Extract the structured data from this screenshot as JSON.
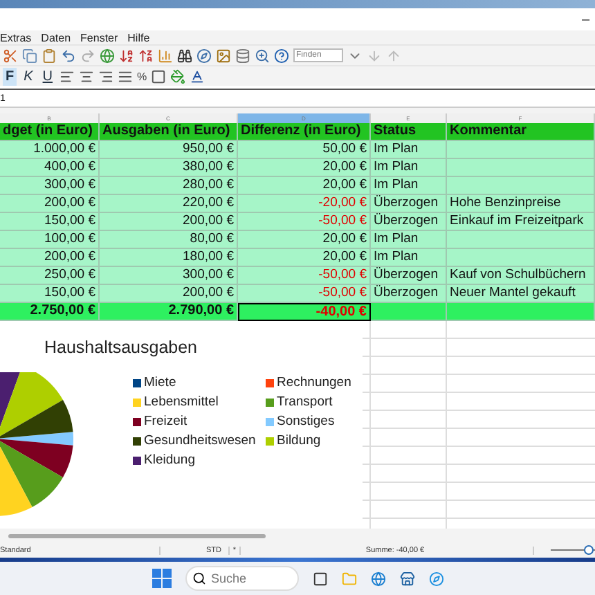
{
  "window": {
    "minimize": "–"
  },
  "menu": [
    {
      "label": "Extras"
    },
    {
      "label": "Daten"
    },
    {
      "label": "Fenster"
    },
    {
      "label": "Hilfe"
    }
  ],
  "find": {
    "placeholder": "Finden"
  },
  "format_buttons": [
    {
      "label": "F",
      "kind": "bold",
      "selected": true
    },
    {
      "label": "K",
      "kind": "italic",
      "selected": false
    },
    {
      "label": "U",
      "kind": "underline",
      "selected": false
    }
  ],
  "percent": "%",
  "formula_bar": {
    "cell": "1"
  },
  "columns": [
    {
      "label": "B",
      "selected": false
    },
    {
      "label": "C",
      "selected": false
    },
    {
      "label": "D",
      "selected": true
    },
    {
      "label": "E",
      "selected": false
    },
    {
      "label": "F",
      "selected": false
    }
  ],
  "header": [
    "dget (in Euro)",
    "Ausgaben (in Euro)",
    "Differenz (in Euro)",
    "Status",
    "Kommentar"
  ],
  "rows": [
    {
      "budget": "1.000,00 €",
      "spent": "950,00 €",
      "diff": "50,00 €",
      "negative": false,
      "status": "Im Plan",
      "comment": ""
    },
    {
      "budget": "400,00 €",
      "spent": "380,00 €",
      "diff": "20,00 €",
      "negative": false,
      "status": "Im Plan",
      "comment": ""
    },
    {
      "budget": "300,00 €",
      "spent": "280,00 €",
      "diff": "20,00 €",
      "negative": false,
      "status": "Im Plan",
      "comment": ""
    },
    {
      "budget": "200,00 €",
      "spent": "220,00 €",
      "diff": "-20,00 €",
      "negative": true,
      "status": "Überzogen",
      "comment": "Hohe Benzinpreise"
    },
    {
      "budget": "150,00 €",
      "spent": "200,00 €",
      "diff": "-50,00 €",
      "negative": true,
      "status": "Überzogen",
      "comment": "Einkauf im Freizeitpark"
    },
    {
      "budget": "100,00 €",
      "spent": "80,00 €",
      "diff": "20,00 €",
      "negative": false,
      "status": "Im Plan",
      "comment": ""
    },
    {
      "budget": "200,00 €",
      "spent": "180,00 €",
      "diff": "20,00 €",
      "negative": false,
      "status": "Im Plan",
      "comment": ""
    },
    {
      "budget": "250,00 €",
      "spent": "300,00 €",
      "diff": "-50,00 €",
      "negative": true,
      "status": "Überzogen",
      "comment": "Kauf von Schulbüchern"
    },
    {
      "budget": "150,00 €",
      "spent": "200,00 €",
      "diff": "-50,00 €",
      "negative": true,
      "status": "Überzogen",
      "comment": "Neuer Mantel gekauft"
    }
  ],
  "total": {
    "budget": "2.750,00 €",
    "spent": "2.790,00 €",
    "diff": "-40,00 €",
    "negative": true
  },
  "chart": {
    "title": "Haushaltsausgaben",
    "legend": [
      {
        "label": "Miete",
        "color": "#004586"
      },
      {
        "label": "Rechnungen",
        "color": "#ff420e"
      },
      {
        "label": "Lebensmittel",
        "color": "#ffd320"
      },
      {
        "label": "Transport",
        "color": "#579d1c"
      },
      {
        "label": "Freizeit",
        "color": "#7e0021"
      },
      {
        "label": "Sonstiges",
        "color": "#83caff"
      },
      {
        "label": "Gesundheitswesen",
        "color": "#314004"
      },
      {
        "label": "Bildung",
        "color": "#aecf00"
      },
      {
        "label": "Kleidung",
        "color": "#4b1f6f"
      }
    ]
  },
  "status_bar": {
    "style": "Standard",
    "mode": "STD",
    "modified": "*",
    "sum": "Summe: -40,00 €",
    "zoom": {
      "level": 0.85
    }
  },
  "taskbar": {
    "search": {
      "placeholder": "Suche"
    }
  }
}
